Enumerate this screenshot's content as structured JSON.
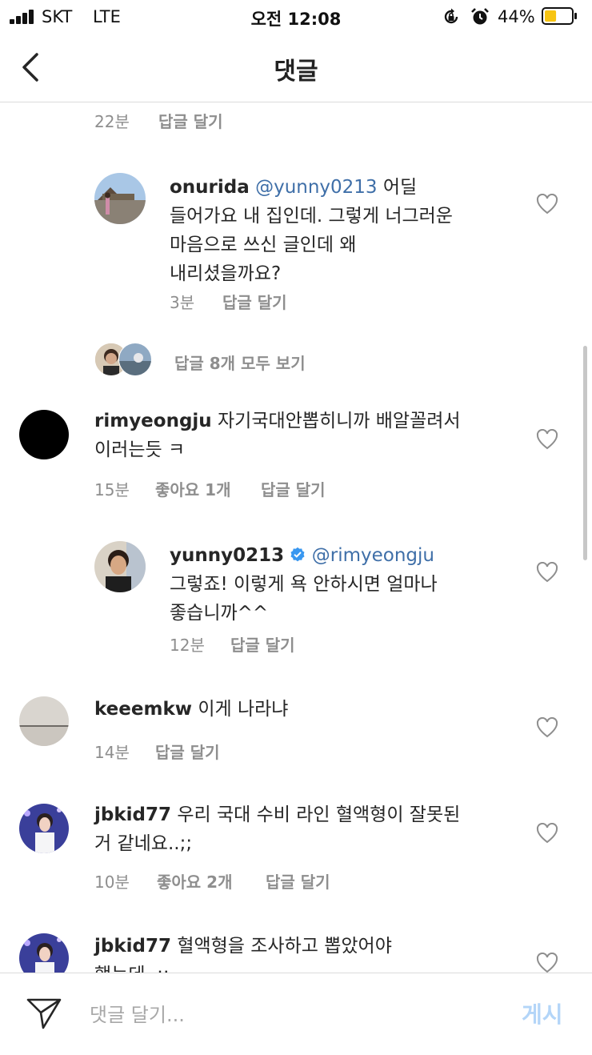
{
  "status_bar": {
    "carrier": "SKT",
    "network": "LTE",
    "time": "오전 12:08",
    "battery": "44%",
    "battery_level": 0.44,
    "icons": [
      "signal-icon",
      "orientation-lock-icon",
      "alarm-icon",
      "battery-icon"
    ]
  },
  "header": {
    "title": "댓글",
    "back_icon": "chevron-left-icon"
  },
  "comments": {
    "top_meta": {
      "time": "22분",
      "reply": "답글 달기"
    },
    "onurida": {
      "username": "onurida",
      "mention": "@yunny0213",
      "lines": [
        "어딜",
        "들어가요 내 집인데. 그렇게 너그러운",
        "마음으로 쓰신 글인데 왜",
        "내리셨을까요?"
      ],
      "time": "3분",
      "reply": "답글 달기"
    },
    "view_replies": "답글 8개 모두 보기",
    "rimyeongju": {
      "username": "rimyeongju",
      "lines": [
        "자기국대안뽑히니까 배알꼴려서",
        "이러는듯 ㅋ"
      ],
      "time": "15분",
      "likes": "좋아요 1개",
      "reply": "답글 달기"
    },
    "yunny": {
      "username": "yunny0213",
      "mention": "@rimyeongju",
      "lines": [
        "그렇죠! 이렇게 욕 안하시면 얼마나",
        "좋습니까^^"
      ],
      "time": "12분",
      "reply": "답글 달기"
    },
    "keeemkw": {
      "username": "keeemkw",
      "lines": [
        "이게 나라냐"
      ],
      "time": "14분",
      "reply": "답글 달기"
    },
    "jbkid_1": {
      "username": "jbkid77",
      "lines": [
        "우리 국대 수비 라인 혈액형이 잘못된",
        "거 같네요..;;"
      ],
      "time": "10분",
      "likes": "좋아요 2개",
      "reply": "답글 달기"
    },
    "jbkid_2": {
      "username": "jbkid77",
      "lines": [
        "혈액형을 조사하고 뽑았어야",
        "했는데..;;"
      ]
    }
  },
  "composer": {
    "placeholder": "댓글 달기...",
    "post_label": "게시",
    "post_color": "#b3d5f8"
  },
  "colors": {
    "text": "#262626",
    "meta": "#8e8e8e",
    "mention": "#3f6fa8",
    "verified": "#3897f0",
    "divider": "#dbdbdb",
    "battery": "#f7c412"
  }
}
